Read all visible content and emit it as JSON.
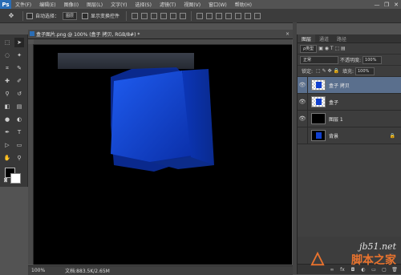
{
  "app": {
    "logo": "Ps",
    "menu": [
      "文件(F)",
      "编辑(E)",
      "图像(I)",
      "图层(L)",
      "文字(Y)",
      "选择(S)",
      "滤镜(T)",
      "视图(V)",
      "窗口(W)",
      "帮助(H)"
    ],
    "window_buttons": [
      "—",
      "❐",
      "✕"
    ]
  },
  "options": {
    "auto_select_label": "自动选择：",
    "auto_select_value": "图层",
    "show_transform_label": "显示变换控件"
  },
  "document": {
    "tab_title": "盒子图片.png @ 100% (盒子 拷贝, RGB/8#) *",
    "close": "×",
    "zoom": "100%",
    "docinfo": "文档:883.5K/2.65M"
  },
  "panels": {
    "tabs": [
      "图层",
      "通道",
      "路径"
    ],
    "kind_label": "ρ类型",
    "blend_mode": "正常",
    "opacity_label": "不透明度:",
    "opacity_value": "100%",
    "lock_label": "锁定:",
    "fill_label": "填充:",
    "fill_value": "100%",
    "layers": [
      {
        "name": "盒子 拷贝",
        "visible": true,
        "selected": true
      },
      {
        "name": "盒子",
        "visible": true,
        "selected": false
      },
      {
        "name": "图层 1",
        "visible": true,
        "selected": false
      },
      {
        "name": "背景",
        "visible": false,
        "selected": false
      }
    ]
  },
  "watermark": {
    "line1": "jb51.net",
    "line2": "脚本之家"
  },
  "colors": {
    "accent": "#2a6db5",
    "cube": "#0a3fd6",
    "selected_layer": "#5a6f8d",
    "watermark_orange": "#e9732e"
  }
}
